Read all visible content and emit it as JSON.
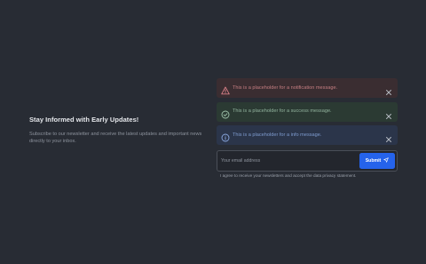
{
  "hero": {
    "title": "Stay Informed with Early Updates!",
    "description": "Subscribe to our newsletter and receive the latest updates and important news directly to your inbox."
  },
  "alerts": [
    {
      "type": "notification",
      "icon": "warning-triangle-icon",
      "message": "This is a placeholder for a notification message.",
      "color": "#c57e82"
    },
    {
      "type": "success",
      "icon": "check-circle-icon",
      "message": "This is a placeholder for a success message.",
      "color": "#93b59f"
    },
    {
      "type": "info",
      "icon": "info-circle-icon",
      "message": "This is a placeholder for a info message.",
      "color": "#7f9cd0"
    }
  ],
  "subscribe": {
    "email_placeholder": "Your email address",
    "button_label": "Submit",
    "button_icon": "send-icon",
    "accent": "#2563eb"
  },
  "consent": {
    "text": "I agree to receive your newsletters and accept the data privacy statement."
  }
}
